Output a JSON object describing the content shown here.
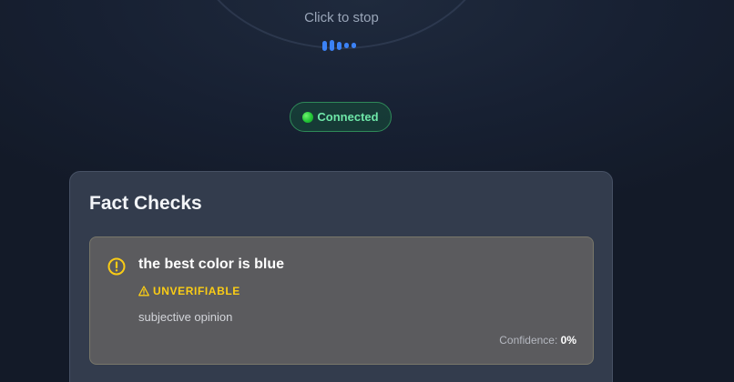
{
  "recorder": {
    "stop_label": "Click to stop",
    "accent_color": "#3b82f6",
    "wave_icon": "audio-wave-icon"
  },
  "status": {
    "label": "Connected",
    "indicator_color": "#22c536",
    "indicator_icon": "status-dot-icon"
  },
  "fact_checks": {
    "title": "Fact Checks",
    "items": [
      {
        "claim": "the best color is blue",
        "status_icon": "alert-circle-icon",
        "verdict_icon": "warning-triangle-icon",
        "verdict": "UNVERIFIABLE",
        "verdict_color": "#facc15",
        "reason": "subjective opinion",
        "confidence_label": "Confidence:",
        "confidence_value": "0%"
      }
    ]
  }
}
